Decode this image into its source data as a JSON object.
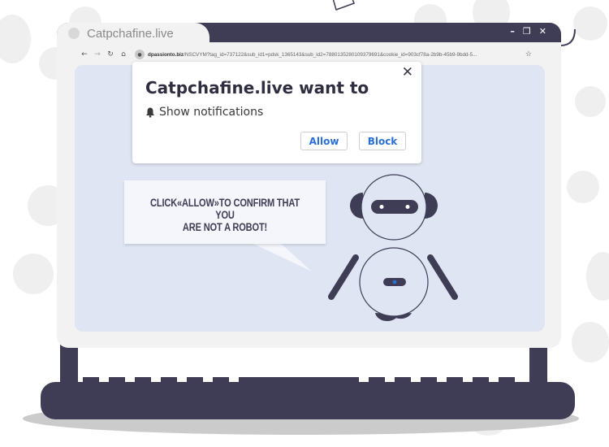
{
  "browser": {
    "tab_title": "Catpchafine.live",
    "tab_icon": "globe-icon",
    "window_controls": {
      "minimize": "–",
      "restore": "❐",
      "close": "✕"
    },
    "nav": {
      "back": "←",
      "forward": "→",
      "reload": "↻",
      "home": "⌂",
      "bookmark": "☆"
    },
    "url_domain": "dpassionto.biz",
    "url_path": "/NSCVYM?tag_id=737122&sub_id1=pdsk_1365143&sub_id2=7880135280109379691&cookie_id=903cf78a-2b9b-45b9-9bdd-5..."
  },
  "dialog": {
    "title": "Catpchafine.live want to",
    "permission_icon": "bell-icon",
    "permission_text": "Show notifications",
    "close_label": "✕",
    "allow_label": "Allow",
    "block_label": "Block"
  },
  "speech": {
    "line1": "CLICK«ALLOW»TO  CONFIRM THAT YOU",
    "line2": "ARE NOT A ROBOT!"
  },
  "colors": {
    "dark": "#3f3d56",
    "content_bg": "#dfe5f2",
    "frame": "#f2f2f2",
    "accent": "#2a6fd6"
  }
}
